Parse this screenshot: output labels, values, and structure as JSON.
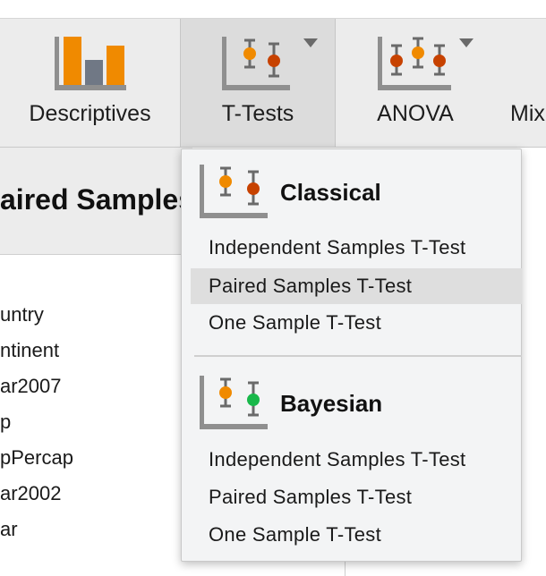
{
  "toolbar": {
    "buttons": [
      {
        "label": "Descriptives",
        "icon": "descriptives-bar-chart-icon"
      },
      {
        "label": "T-Tests",
        "icon": "t-tests-icon",
        "has_dropdown": true,
        "active": true
      },
      {
        "label": "ANOVA",
        "icon": "anova-icon",
        "has_dropdown": true
      },
      {
        "label": "Mix",
        "icon": "none"
      }
    ]
  },
  "panel": {
    "title": "aired Samples",
    "variables": [
      "untry",
      "ntinent",
      "ar2007",
      "p",
      "pPercap",
      "ar2002",
      "ar"
    ]
  },
  "menu": {
    "groups": [
      {
        "title": "Classical",
        "icon": "classical-t-test-icon",
        "items": [
          "Independent Samples T-Test",
          "Paired Samples T-Test",
          "One Sample T-Test"
        ],
        "highlighted_index": 1
      },
      {
        "title": "Bayesian",
        "icon": "bayesian-t-test-icon",
        "items": [
          "Independent Samples T-Test",
          "Paired Samples T-Test",
          "One Sample T-Test"
        ]
      }
    ]
  },
  "colors": {
    "orange": "#f08a00",
    "dark_orange": "#c74200",
    "green": "#18b84a",
    "gray_axis": "#8a8a8a",
    "highlight": "#dedede"
  }
}
